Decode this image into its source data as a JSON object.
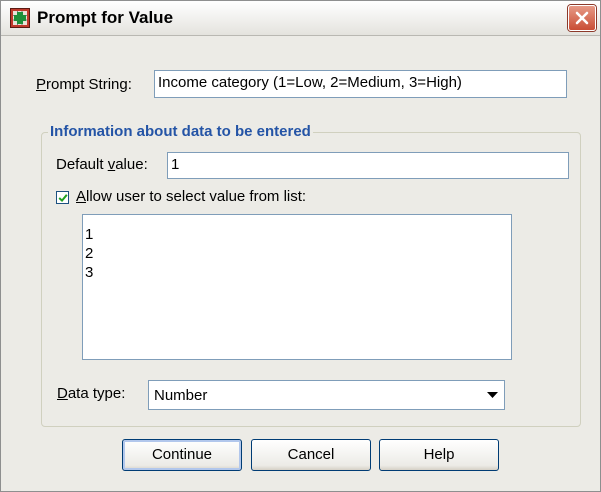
{
  "window": {
    "title": "Prompt for Value",
    "app_icon": "spss-dialog-icon",
    "close_icon": "close-icon"
  },
  "prompt_string": {
    "label_mnemonic": "P",
    "label_rest": "rompt String:",
    "value": "Income category (1=Low, 2=Medium, 3=High)"
  },
  "info_group": {
    "title": "Information about data to be entered",
    "default_value": {
      "label_before": "Default ",
      "label_mnemonic": "v",
      "label_after": "alue:",
      "value": "1"
    },
    "allow_list": {
      "checked": true,
      "label_mnemonic": "A",
      "label_rest": "llow user to select value from list:"
    },
    "values": [
      "1",
      "2",
      "3"
    ],
    "data_type": {
      "label_mnemonic": "D",
      "label_rest": "ata type:",
      "selected": "Number",
      "arrow_icon": "chevron-down-icon"
    }
  },
  "buttons": {
    "continue": "Continue",
    "cancel": "Cancel",
    "help": "Help"
  },
  "colors": {
    "group_title": "#2454a6",
    "field_border": "#7f9db9",
    "close_button": "#c94d35"
  }
}
